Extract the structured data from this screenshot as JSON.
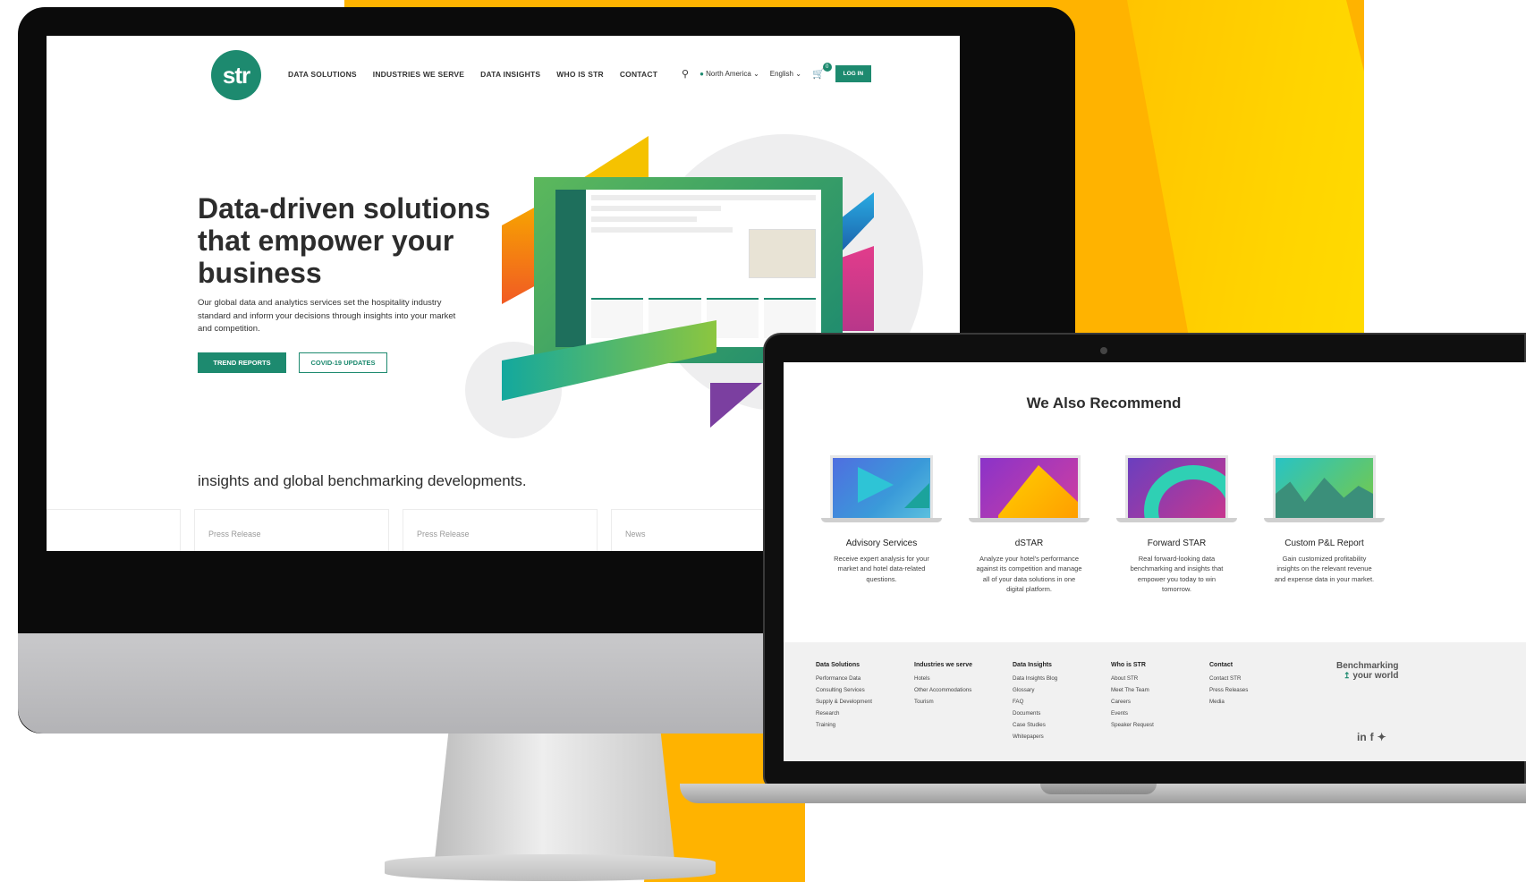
{
  "site": {
    "logo_text": "str",
    "nav": [
      "DATA SOLUTIONS",
      "INDUSTRIES WE SERVE",
      "DATA INSIGHTS",
      "WHO IS STR",
      "CONTACT"
    ],
    "region": "North America",
    "language": "English",
    "cart_count": "0",
    "login_label": "LOG IN"
  },
  "hero": {
    "title": "Data-driven solutions that empower your business",
    "text": "Our global data and analytics services set the hospitality industry standard and inform your decisions through insights into your market and competition.",
    "btn_primary": "TREND REPORTS",
    "btn_secondary": "COVID-19 UPDATES"
  },
  "press": {
    "heading": "insights and global benchmarking developments.",
    "cards": [
      "",
      "Press Release",
      "Press Release",
      "News"
    ]
  },
  "recommend": {
    "title": "We Also Recommend",
    "products": [
      {
        "name": "Advisory Services",
        "desc": "Receive expert analysis for your market and hotel data-related questions."
      },
      {
        "name": "dSTAR",
        "desc": "Analyze your hotel's performance against its competition and manage all of your data solutions in one digital platform."
      },
      {
        "name": "Forward STAR",
        "desc": "Real forward-looking data benchmarking and insights that empower you today to win tomorrow."
      },
      {
        "name": "Custom P&L Report",
        "desc": "Gain customized profitability insights on the relevant revenue and expense data in your market."
      }
    ]
  },
  "footer": {
    "columns": [
      {
        "title": "Data Solutions",
        "links": [
          "Performance Data",
          "Consulting Services",
          "Supply & Development",
          "Research",
          "Training"
        ]
      },
      {
        "title": "Industries we serve",
        "links": [
          "Hotels",
          "Other Accommodations",
          "Tourism"
        ]
      },
      {
        "title": "Data Insights",
        "links": [
          "Data Insights Blog",
          "Glossary",
          "FAQ",
          "Documents",
          "Case Studies",
          "Whitepapers"
        ]
      },
      {
        "title": "Who is STR",
        "links": [
          "About STR",
          "Meet The Team",
          "Careers",
          "Events",
          "Speaker Request"
        ]
      },
      {
        "title": "Contact",
        "links": [
          "Contact STR",
          "Press Releases",
          "Media"
        ]
      }
    ],
    "tagline_1": "Benchmarking",
    "tagline_2": "your world",
    "social": [
      "in",
      "f",
      "t"
    ]
  },
  "colors": {
    "brand": "#1d8a6f",
    "accent_yellow": "#ffb300"
  }
}
